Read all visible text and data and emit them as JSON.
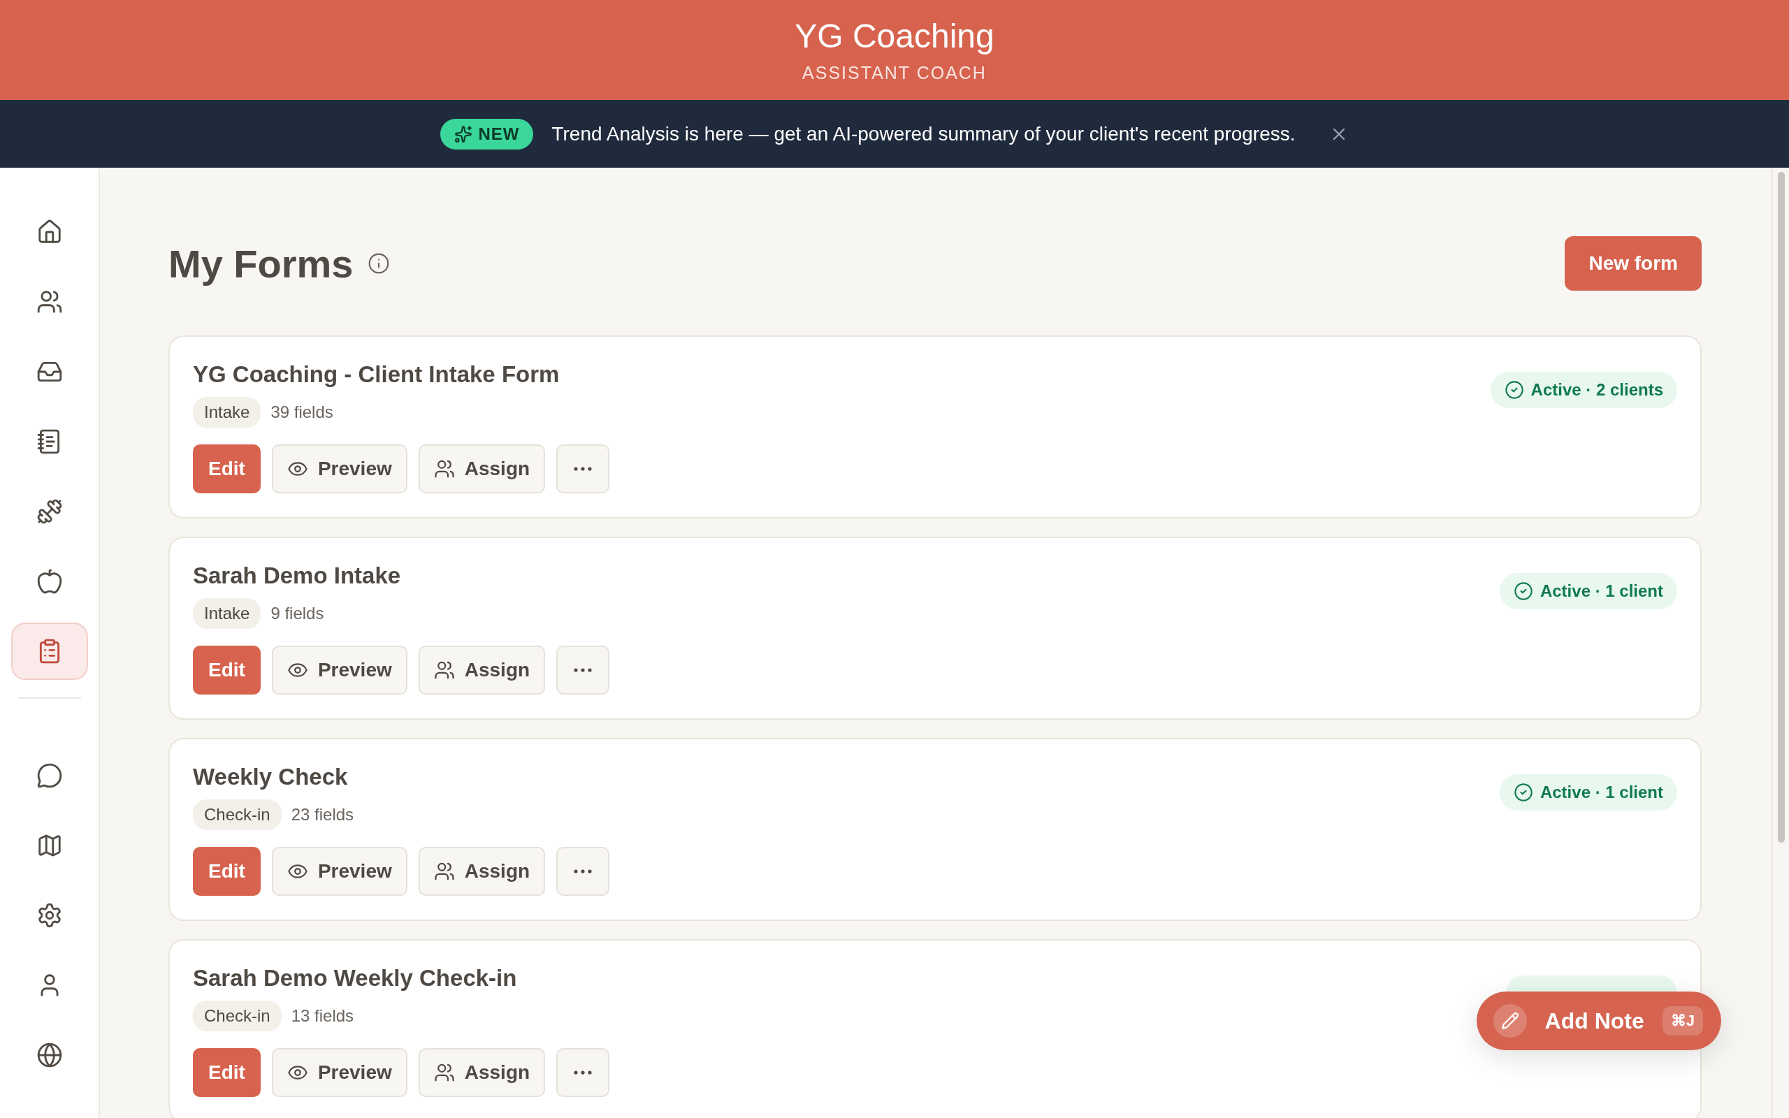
{
  "header": {
    "title": "YG Coaching",
    "subtitle": "ASSISTANT COACH"
  },
  "banner": {
    "badge": "NEW",
    "message": "Trend Analysis is here — get an AI-powered summary of your client's recent progress."
  },
  "sidebar": {
    "groups": [
      [
        {
          "selected": false
        },
        {
          "selected": false
        },
        {
          "selected": false
        },
        {
          "selected": false
        },
        {
          "selected": false
        },
        {
          "selected": false
        },
        {
          "selected": true
        }
      ],
      [
        {
          "selected": false
        },
        {
          "selected": false
        },
        {
          "selected": false
        },
        {
          "selected": false
        },
        {
          "selected": false
        }
      ]
    ]
  },
  "page": {
    "title": "My Forms",
    "new_button": "New form"
  },
  "forms": [
    {
      "title": "YG Coaching - Client Intake Form",
      "tag": "Intake",
      "fields": "39 fields",
      "status": "Active · 2 clients",
      "actions": [
        "Edit",
        "Preview",
        "Assign"
      ]
    },
    {
      "title": "Sarah Demo Intake",
      "tag": "Intake",
      "fields": "9 fields",
      "status": "Active · 1 client",
      "actions": [
        "Edit",
        "Preview",
        "Assign"
      ]
    },
    {
      "title": "Weekly Check",
      "tag": "Check-in",
      "fields": "23 fields",
      "status": "Active · 1 client",
      "actions": [
        "Edit",
        "Preview",
        "Assign"
      ]
    },
    {
      "title": "Sarah Demo Weekly Check-in",
      "tag": "Check-in",
      "fields": "13 fields",
      "status_covered": true,
      "actions": [
        "Edit",
        "Preview",
        "Assign"
      ]
    }
  ],
  "note_button": {
    "label": "Add Note",
    "shortcut": "⌘J"
  }
}
